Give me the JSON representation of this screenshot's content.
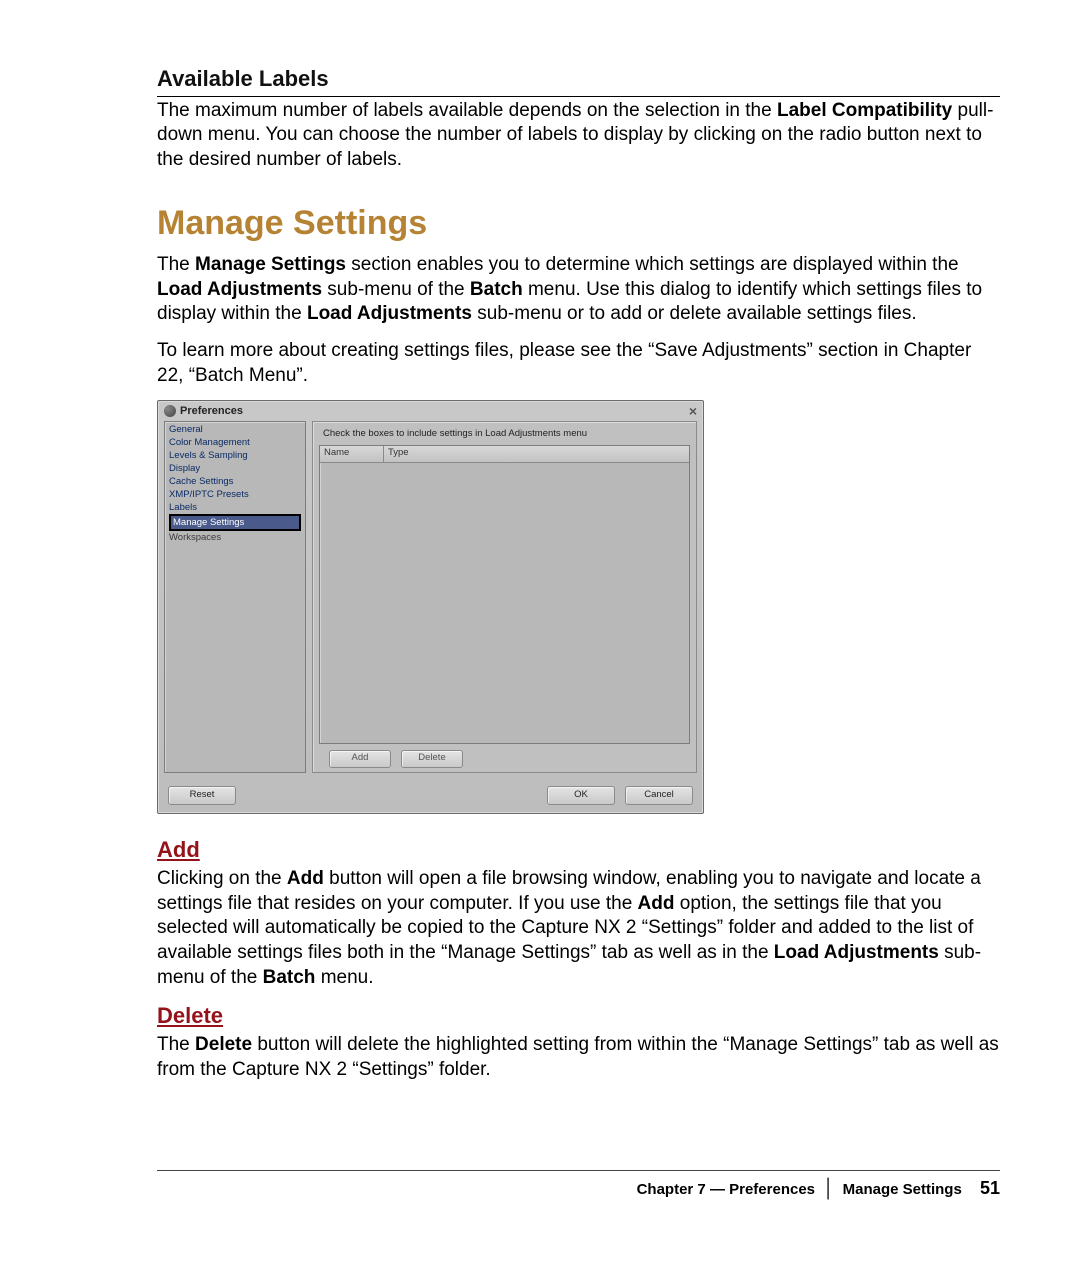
{
  "headings": {
    "available_labels": "Available Labels",
    "manage_settings": "Manage Settings",
    "add": "Add",
    "delete": "Delete"
  },
  "paragraphs": {
    "available_labels_body_1": "The maximum number of labels available depends on the selection in the ",
    "available_labels_bold_1": "Label Compatibility",
    "available_labels_body_2": " pull-down menu. You can choose the number of labels to display by clicking on the radio button next to the desired number of labels.",
    "manage_intro_1": "The ",
    "manage_intro_bold_1": "Manage Settings",
    "manage_intro_2": " section enables you to determine which settings are displayed within the ",
    "manage_intro_bold_2": "Load Adjustments",
    "manage_intro_3": " sub-menu of the ",
    "manage_intro_bold_3": "Batch",
    "manage_intro_4": " menu. Use this dialog to identify which settings files to display within the ",
    "manage_intro_bold_4": "Load Adjustments",
    "manage_intro_5": " sub-menu or to add or delete available settings files.",
    "manage_learn": "To learn more about creating settings files, please see the “Save Adjustments” section in Chapter 22, “Batch Menu”.",
    "add_body_1": "Clicking on the ",
    "add_bold_1": "Add",
    "add_body_2": " button will open a file browsing window, enabling you to navigate and locate a settings file that resides on your computer. If you use the ",
    "add_bold_2": "Add",
    "add_body_3": " option, the settings file that you selected will automatically be copied to the Capture NX 2 “Settings” folder and added to the list of available settings files both in the “Manage Settings” tab as well as in the ",
    "add_bold_3": "Load Adjustments",
    "add_body_4": " sub-menu of the ",
    "add_bold_4": "Batch",
    "add_body_5": " menu.",
    "delete_body_1": "The ",
    "delete_bold_1": "Delete",
    "delete_body_2": " button will delete the highlighted setting from within the “Manage Settings” tab as well as from the Capture NX 2 “Settings” folder."
  },
  "dialog": {
    "title": "Preferences",
    "instruction": "Check the boxes to include settings in Load Adjustments menu",
    "columns": {
      "name": "Name",
      "type": "Type"
    },
    "sidebar": [
      "General",
      "Color Management",
      "Levels & Sampling",
      "Display",
      "Cache Settings",
      "XMP/IPTC Presets",
      "Labels",
      "Manage Settings",
      "Workspaces"
    ],
    "buttons": {
      "add": "Add",
      "delete": "Delete",
      "reset": "Reset",
      "ok": "OK",
      "cancel": "Cancel"
    }
  },
  "footer": {
    "chapter": "Chapter 7 — Preferences",
    "section": "Manage Settings",
    "page": "51"
  }
}
